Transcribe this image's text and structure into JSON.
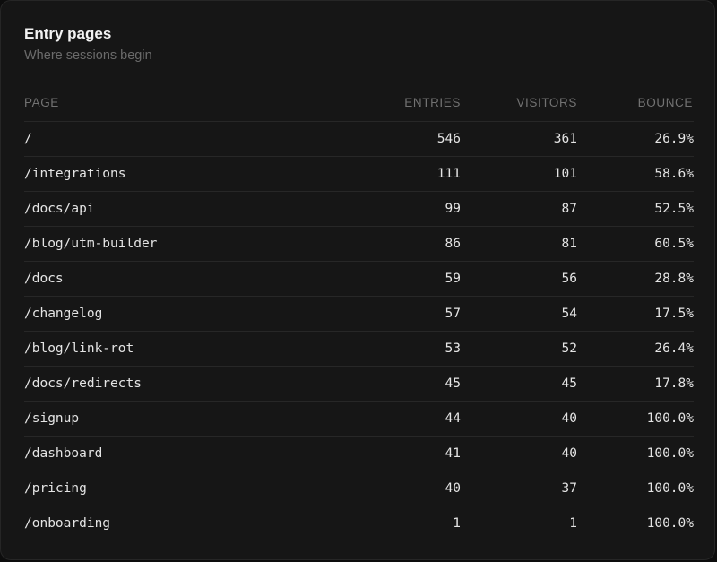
{
  "panel": {
    "title": "Entry pages",
    "subtitle": "Where sessions begin"
  },
  "table": {
    "columns": {
      "page": "PAGE",
      "entries": "ENTRIES",
      "visitors": "VISITORS",
      "bounce": "BOUNCE"
    },
    "rows": [
      {
        "page": "/",
        "entries": "546",
        "visitors": "361",
        "bounce": "26.9%"
      },
      {
        "page": "/integrations",
        "entries": "111",
        "visitors": "101",
        "bounce": "58.6%"
      },
      {
        "page": "/docs/api",
        "entries": "99",
        "visitors": "87",
        "bounce": "52.5%"
      },
      {
        "page": "/blog/utm-builder",
        "entries": "86",
        "visitors": "81",
        "bounce": "60.5%"
      },
      {
        "page": "/docs",
        "entries": "59",
        "visitors": "56",
        "bounce": "28.8%"
      },
      {
        "page": "/changelog",
        "entries": "57",
        "visitors": "54",
        "bounce": "17.5%"
      },
      {
        "page": "/blog/link-rot",
        "entries": "53",
        "visitors": "52",
        "bounce": "26.4%"
      },
      {
        "page": "/docs/redirects",
        "entries": "45",
        "visitors": "45",
        "bounce": "17.8%"
      },
      {
        "page": "/signup",
        "entries": "44",
        "visitors": "40",
        "bounce": "100.0%"
      },
      {
        "page": "/dashboard",
        "entries": "41",
        "visitors": "40",
        "bounce": "100.0%"
      },
      {
        "page": "/pricing",
        "entries": "40",
        "visitors": "37",
        "bounce": "100.0%"
      },
      {
        "page": "/onboarding",
        "entries": "1",
        "visitors": "1",
        "bounce": "100.0%"
      }
    ]
  }
}
